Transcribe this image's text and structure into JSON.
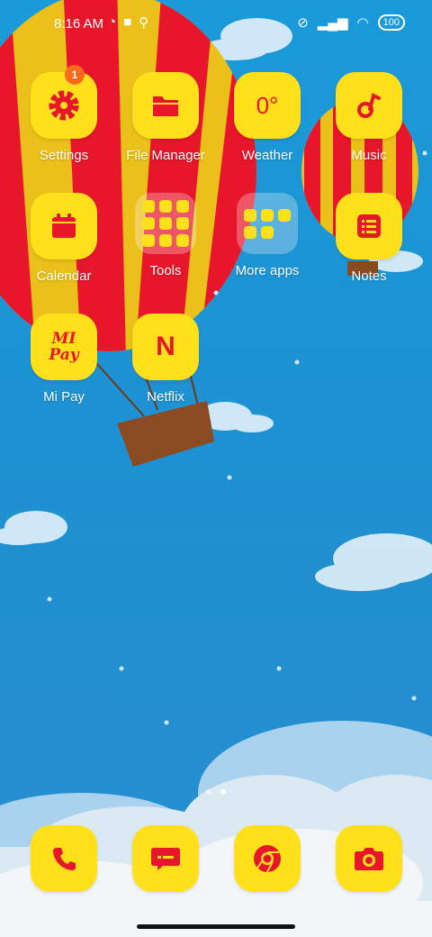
{
  "status_bar": {
    "time": "8:16 AM",
    "battery": "100"
  },
  "apps": {
    "settings": {
      "label": "Settings",
      "badge": "1"
    },
    "file_manager": {
      "label": "File Manager"
    },
    "weather": {
      "label": "Weather",
      "value": "0°"
    },
    "music": {
      "label": "Music"
    },
    "calendar": {
      "label": "Calendar"
    },
    "tools": {
      "label": "Tools"
    },
    "more_apps": {
      "label": "More apps"
    },
    "notes": {
      "label": "Notes"
    },
    "mi_pay": {
      "label": "Mi Pay",
      "icon_text_1": "MI",
      "icon_text_2": "Pay"
    },
    "netflix": {
      "label": "Netflix",
      "icon_text": "N"
    }
  },
  "dock": [
    {
      "name": "phone"
    },
    {
      "name": "messaging"
    },
    {
      "name": "chrome"
    },
    {
      "name": "camera"
    }
  ],
  "page_indicator": {
    "pages": 2,
    "active": 2
  },
  "colors": {
    "icon_bg": "#ffe01a",
    "icon_fg": "#e8162b",
    "badge": "#ff6a1a",
    "sky": "#1f8fd0"
  }
}
